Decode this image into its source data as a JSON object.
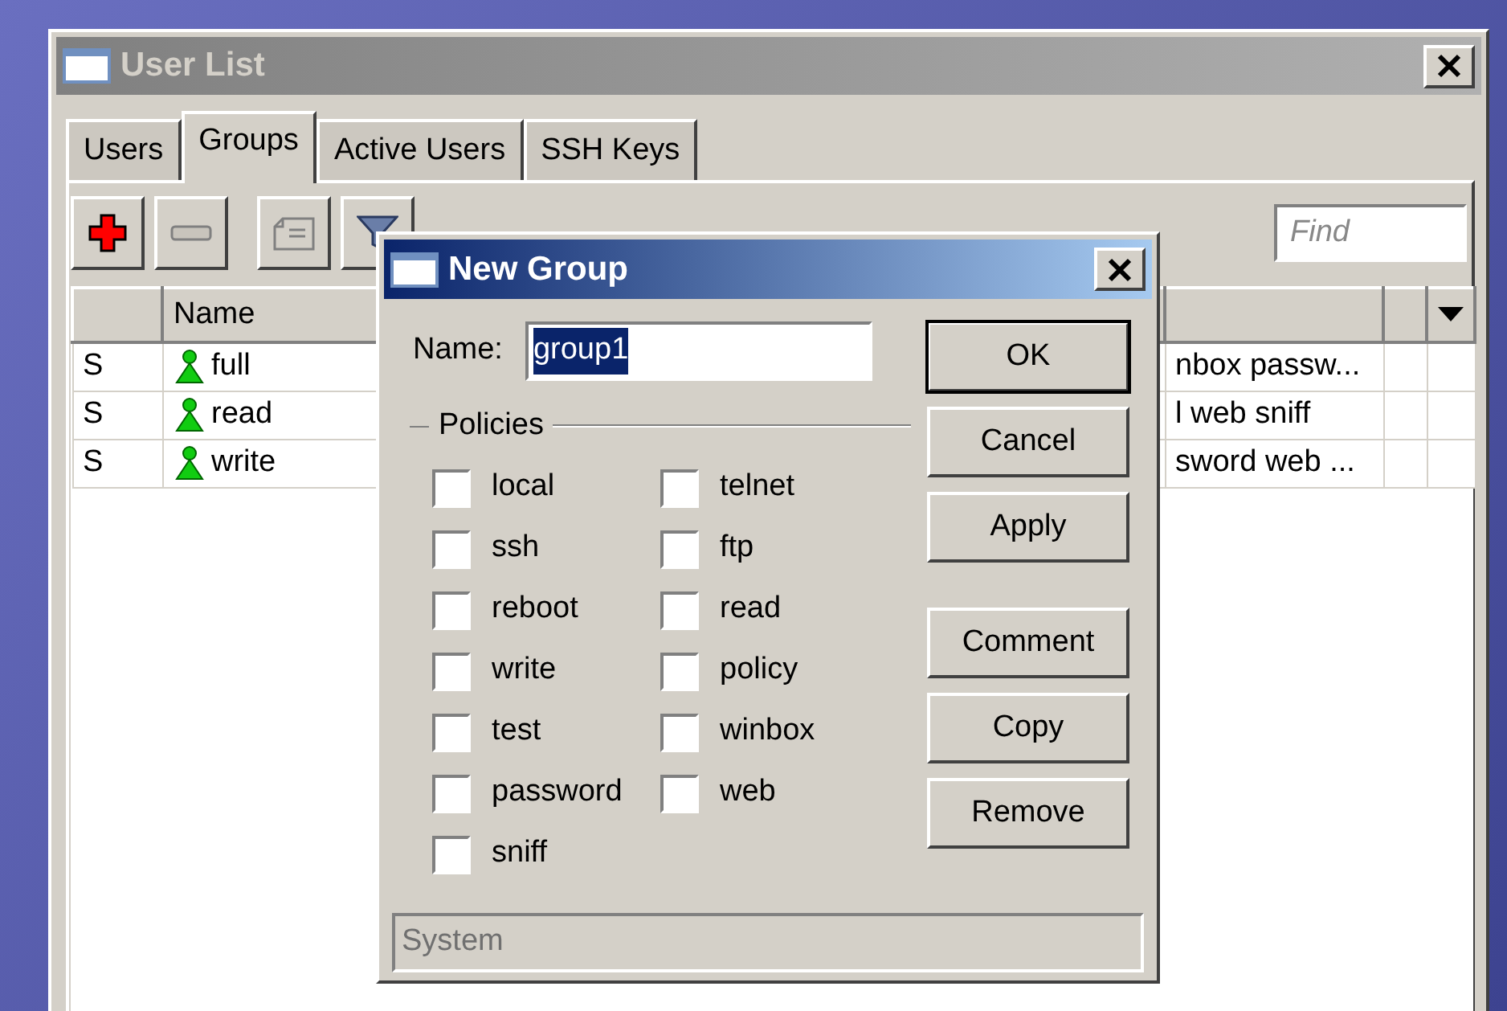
{
  "window": {
    "title": "User List"
  },
  "tabs": [
    {
      "label": "Users",
      "selected": false
    },
    {
      "label": "Groups",
      "selected": true
    },
    {
      "label": "Active Users",
      "selected": false
    },
    {
      "label": "SSH Keys",
      "selected": false
    }
  ],
  "toolbar": {
    "buttons": [
      {
        "kind": "add"
      },
      {
        "kind": "remove"
      },
      {
        "kind": "comment"
      },
      {
        "kind": "filter"
      }
    ],
    "find": {
      "placeholder": "Find"
    }
  },
  "table": {
    "columns": [
      "Name"
    ],
    "rows": [
      {
        "flag": "S",
        "name": "full",
        "column_3": "nbox passw..."
      },
      {
        "flag": "S",
        "name": "read",
        "column_3": "l web sniff"
      },
      {
        "flag": "S",
        "name": "write",
        "column_3": "sword web ..."
      }
    ]
  },
  "dialog": {
    "title": "New Group",
    "name_label": "Name:",
    "name_value": "group1",
    "policies_label": "Policies",
    "policies": [
      {
        "label": "local",
        "checked": false
      },
      {
        "label": "telnet",
        "checked": false
      },
      {
        "label": "ssh",
        "checked": false
      },
      {
        "label": "ftp",
        "checked": false
      },
      {
        "label": "reboot",
        "checked": false
      },
      {
        "label": "read",
        "checked": false
      },
      {
        "label": "write",
        "checked": false
      },
      {
        "label": "policy",
        "checked": false
      },
      {
        "label": "test",
        "checked": false
      },
      {
        "label": "winbox",
        "checked": false
      },
      {
        "label": "password",
        "checked": false
      },
      {
        "label": "web",
        "checked": false
      },
      {
        "label": "sniff",
        "checked": false
      }
    ],
    "button_groups": [
      [
        {
          "label": "OK",
          "default": true
        },
        {
          "label": "Cancel",
          "default": false
        },
        {
          "label": "Apply",
          "default": false
        }
      ],
      [
        {
          "label": "Comment",
          "default": false
        },
        {
          "label": "Copy",
          "default": false
        },
        {
          "label": "Remove",
          "default": false
        }
      ]
    ],
    "status": "System"
  }
}
